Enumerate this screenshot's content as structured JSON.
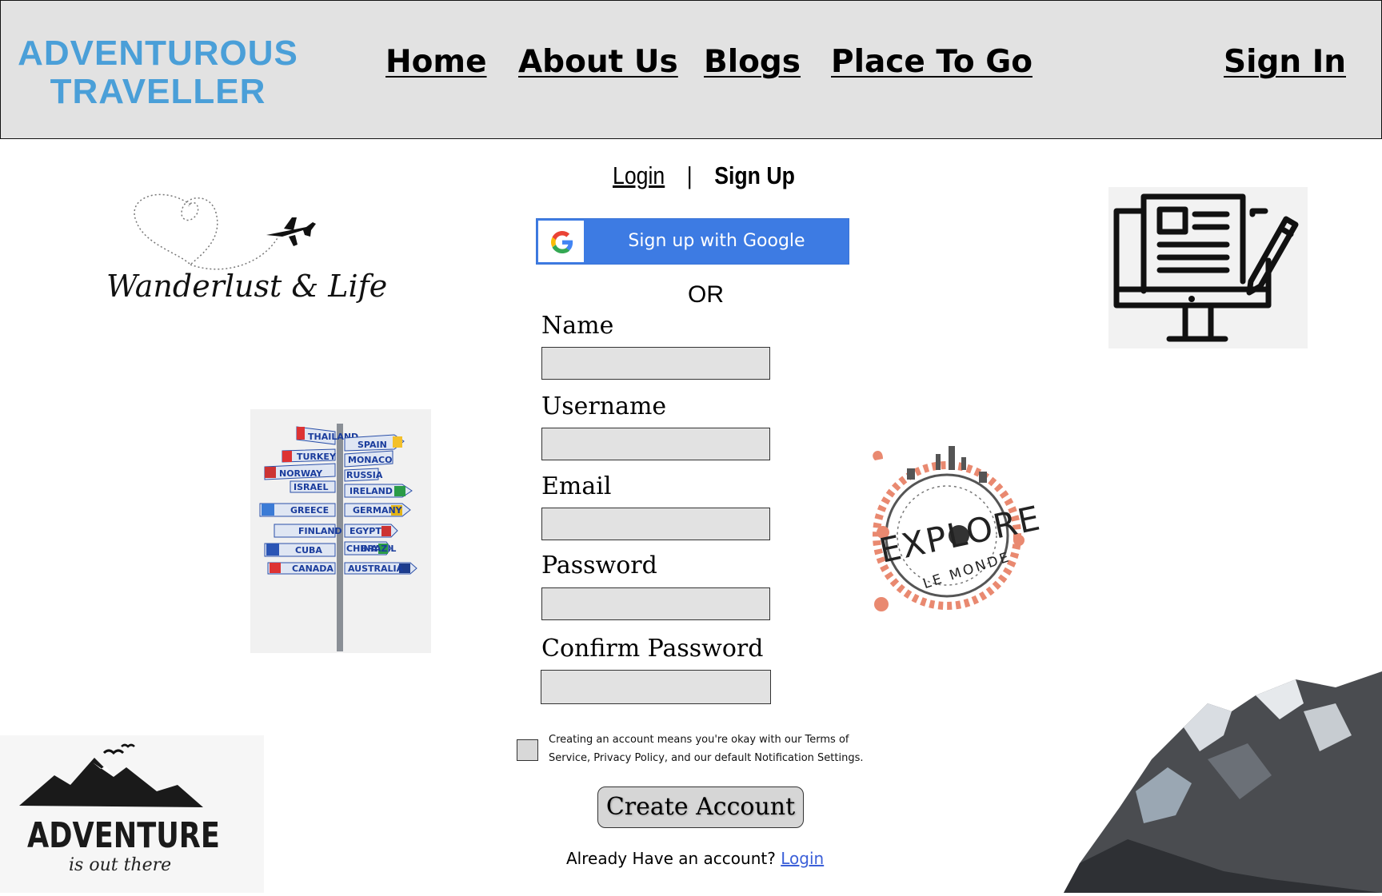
{
  "header": {
    "brand_line1": "ADVENTUROUS",
    "brand_line2": "TRAVELLER",
    "nav": {
      "home": "Home",
      "about": "About Us",
      "blogs": "Blogs",
      "places": "Place To Go",
      "sign_in": "Sign In"
    }
  },
  "auth": {
    "login_tab": "Login",
    "separator": "|",
    "signup_tab": "Sign Up"
  },
  "google": {
    "label": "Sign up with Google"
  },
  "or_text": "OR",
  "form": {
    "name_label": "Name",
    "username_label": "Username",
    "email_label": "Email",
    "password_label": "Password",
    "confirm_label": "Confirm Password",
    "name_value": "",
    "username_value": "",
    "email_value": "",
    "password_value": "",
    "confirm_value": ""
  },
  "terms": {
    "text": "Creating an account means you're okay with our Terms of Service, Privacy Policy, and our default Notification Settings."
  },
  "create_button": "Create Account",
  "footer_prompt": {
    "text": "Already Have an account?",
    "link": "Login"
  },
  "images": {
    "wanderlust_text": "Wanderlust & Life",
    "adventure_title": "ADVENTURE",
    "adventure_sub": "is out there",
    "explore_title": "EXPLORE",
    "explore_sub": "LE MONDE",
    "signpost_labels": [
      "THAILAND",
      "SPAIN",
      "TURKEY",
      "MONACO",
      "NORWAY",
      "RUSSIA",
      "ISRAEL",
      "IRELAND",
      "GREECE",
      "GERMANY",
      "FINLAND",
      "EGYPT",
      "CUBA",
      "CHINA",
      "BRAZIL",
      "CANADA",
      "AUSTRALIA"
    ]
  },
  "colors": {
    "brand": "#4a9fd8",
    "header_bg": "#e2e2e2",
    "google_blue": "#3d7be3",
    "link": "#3b5fd8"
  }
}
